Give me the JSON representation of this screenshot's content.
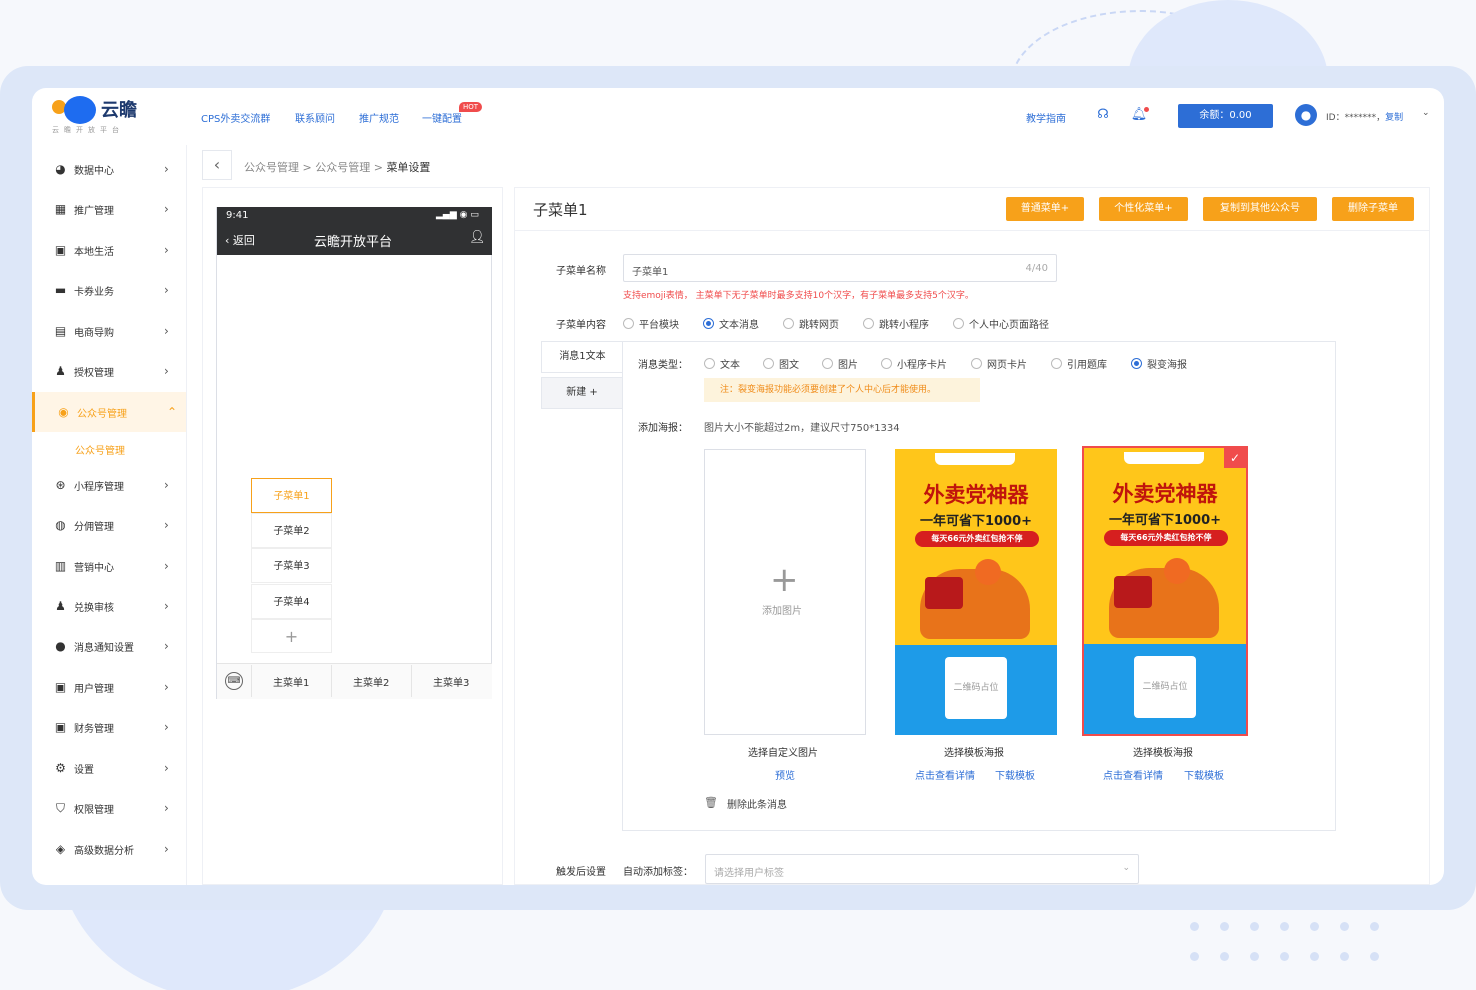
{
  "header": {
    "logo_text": "云瞻",
    "logo_sub": "云瞻开放平台",
    "nav": [
      "CPS外卖交流群",
      "联系顾问",
      "推广规范",
      "一键配置"
    ],
    "hot_badge": "HOT",
    "guide": "教学指南",
    "balance": "余额：0.00",
    "user_id": "ID：*******，",
    "copy": "复制",
    "icons": [
      "headset-icon",
      "bell-icon",
      "avatar-icon",
      "chevron-down-icon"
    ]
  },
  "sidebar": {
    "items": [
      {
        "label": "数据中心",
        "icon": "chart-icon"
      },
      {
        "label": "推广管理",
        "icon": "grid-icon"
      },
      {
        "label": "本地生活",
        "icon": "store-icon"
      },
      {
        "label": "卡券业务",
        "icon": "ticket-icon"
      },
      {
        "label": "电商导购",
        "icon": "shop-icon"
      },
      {
        "label": "授权管理",
        "icon": "user-key-icon"
      },
      {
        "label": "公众号管理",
        "icon": "wechat-icon"
      },
      {
        "label": "小程序管理",
        "icon": "miniapp-icon"
      },
      {
        "label": "分佣管理",
        "icon": "commission-icon"
      },
      {
        "label": "营销中心",
        "icon": "gift-icon"
      },
      {
        "label": "兑换审核",
        "icon": "user-check-icon"
      },
      {
        "label": "消息通知设置",
        "icon": "chat-icon"
      },
      {
        "label": "用户管理",
        "icon": "users-icon"
      },
      {
        "label": "财务管理",
        "icon": "finance-icon"
      },
      {
        "label": "设置",
        "icon": "gear-icon"
      },
      {
        "label": "权限管理",
        "icon": "shield-icon"
      },
      {
        "label": "高级数据分析",
        "icon": "layers-icon"
      }
    ],
    "active_sub": "公众号管理"
  },
  "breadcrumb": [
    "公众号管理",
    "公众号管理",
    "菜单设置"
  ],
  "phone": {
    "time": "9:41",
    "back": "返回",
    "title": "云瞻开放平台",
    "submenus": [
      "子菜单1",
      "子菜单2",
      "子菜单3",
      "子菜单4"
    ],
    "add": "+",
    "mainmenus": [
      "主菜单1",
      "主菜单2",
      "主菜单3"
    ]
  },
  "editor": {
    "title": "子菜单1",
    "buttons": [
      "普通菜单+",
      "个性化菜单+",
      "复制到其他公众号",
      "删除子菜单"
    ],
    "name_label": "子菜单名称",
    "name_value": "子菜单1",
    "name_count": "4/40",
    "name_warning": "支持emoji表情，  主菜单下无子菜单时最多支持10个汉字，有子菜单最多支持5个汉字。",
    "content_label": "子菜单内容",
    "content_options": [
      "平台模块",
      "文本消息",
      "跳转网页",
      "跳转小程序",
      "个人中心页面路径"
    ],
    "content_selected": "文本消息",
    "msg_tabs": [
      "消息1文本",
      "新建 +"
    ],
    "msg_type_label": "消息类型：",
    "msg_types": [
      "文本",
      "图文",
      "图片",
      "小程序卡片",
      "网页卡片",
      "引用题库",
      "裂变海报"
    ],
    "msg_type_selected": "裂变海报",
    "note": "注：裂变海报功能必须要创建了个人中心后才能使用。",
    "poster_label": "添加海报：",
    "poster_hint": "图片大小不能超过2m，建议尺寸750*1334",
    "upload_text": "添加图片",
    "upload_caption": "选择自定义图片",
    "upload_link": "预览",
    "poster_title": "外卖党神器",
    "poster_sub": "一年可省下1000+",
    "poster_pill": "每天66元外卖红包抢不停",
    "poster_qr": "二维码占位",
    "template_caption": "选择模板海报",
    "template_links": [
      "点击查看详情",
      "下载模板"
    ],
    "delete_msg": "删除此条消息",
    "trigger_label": "触发后设置",
    "auto_tag_label": "自动添加标签：",
    "tag_placeholder": "请选择用户标签"
  },
  "colors": {
    "accent": "#f7a11a",
    "primary": "#2d6ed6",
    "danger": "#f04c4c"
  }
}
